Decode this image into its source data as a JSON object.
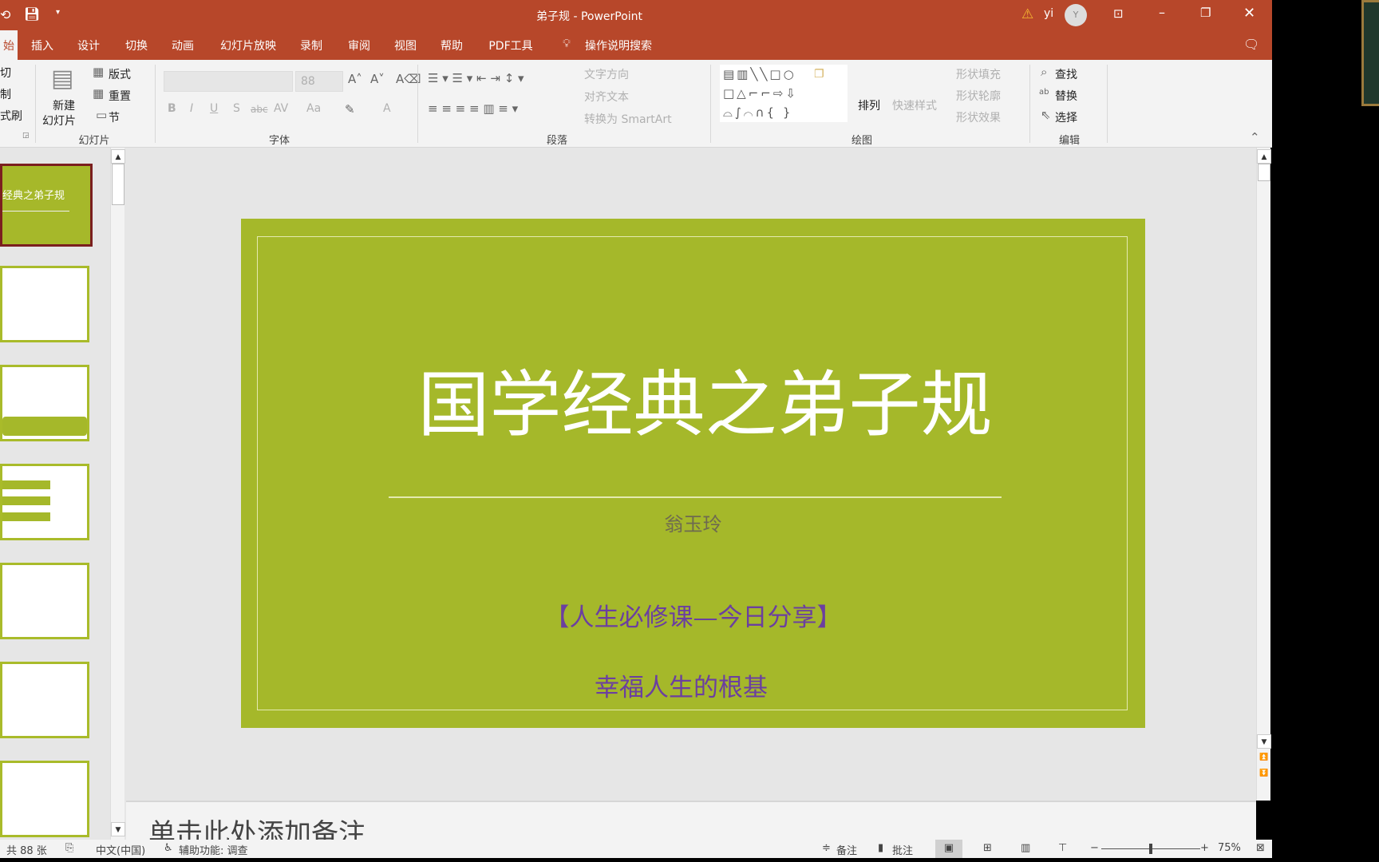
{
  "window": {
    "title": "弟子规 - PowerPoint",
    "user": "yi",
    "avatar_initial": "Y",
    "brand_color": "#b7472a"
  },
  "tabs": [
    {
      "label": "始",
      "active": true
    },
    {
      "label": "插入"
    },
    {
      "label": "设计"
    },
    {
      "label": "切换"
    },
    {
      "label": "动画"
    },
    {
      "label": "幻灯片放映"
    },
    {
      "label": "录制"
    },
    {
      "label": "审阅"
    },
    {
      "label": "视图"
    },
    {
      "label": "帮助"
    },
    {
      "label": "PDF工具"
    }
  ],
  "tell_me": "操作说明搜索",
  "ribbon": {
    "clipboard": {
      "cut": "切",
      "copy": "制",
      "format_painter": "式刷"
    },
    "slides": {
      "label": "幻灯片",
      "new_slide_1": "新建",
      "new_slide_2": "幻灯片",
      "layout": "版式",
      "reset": "重置",
      "section": "节"
    },
    "font": {
      "label": "字体",
      "font_name": "",
      "font_size": "88",
      "bold": "B",
      "italic": "I",
      "underline": "U",
      "shadow": "S",
      "strike": "abc",
      "spacing": "AV",
      "case": "Aa",
      "color": "A"
    },
    "paragraph": {
      "label": "段落",
      "text_direction": "文字方向",
      "align_text": "对齐文本",
      "smartart": "转换为 SmartArt"
    },
    "drawing": {
      "label": "绘图",
      "arrange": "排列",
      "quick_styles": "快速样式",
      "fill": "形状填充",
      "outline": "形状轮廓",
      "effects": "形状效果"
    },
    "editing": {
      "label": "编辑",
      "find": "查找",
      "replace": "替换",
      "select": "选择"
    }
  },
  "thumbnail_title": "经典之弟子规",
  "slide": {
    "title": "国学经典之弟子规",
    "author": "翁玉玲",
    "subtitle": "【人生必修课—今日分享】",
    "tagline": "幸福人生的根基",
    "bg_color": "#a5b82a",
    "accent_text": "#6b3fa0"
  },
  "notes_placeholder": "单击此处添加备注",
  "status": {
    "slide_count": "共 88 张",
    "language": "中文(中国)",
    "accessibility": "辅助功能: 调查",
    "notes": "备注",
    "comments": "批注",
    "zoom": "75%",
    "zoom_level": 0.5
  }
}
